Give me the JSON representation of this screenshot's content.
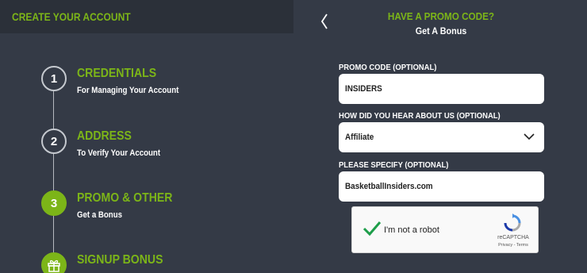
{
  "left_panel": {
    "title": "CREATE YOUR ACCOUNT",
    "steps": [
      {
        "number": "1",
        "title": "CREDENTIALS",
        "subtitle": "For Managing Your Account",
        "active": false
      },
      {
        "number": "2",
        "title": "ADDRESS",
        "subtitle": "To Verify Your Account",
        "active": false
      },
      {
        "number": "3",
        "title": "PROMO & OTHER",
        "subtitle": "Get a Bonus",
        "active": true
      },
      {
        "number": "",
        "title": "SIGNUP BONUS",
        "subtitle": "",
        "active": true,
        "icon": "gift-icon"
      }
    ]
  },
  "right_panel": {
    "back_icon": "chevron-left-icon",
    "heading": "HAVE A PROMO CODE?",
    "subheading": "Get A Bonus",
    "promo_code": {
      "label": "PROMO CODE (OPTIONAL)",
      "value": "INSIDERS"
    },
    "referral_source": {
      "label": "HOW DID YOU HEAR ABOUT US (OPTIONAL)",
      "value": "Affiliate"
    },
    "specify": {
      "label": "PLEASE SPECIFY (OPTIONAL)",
      "value": "BasketballInsiders.com"
    },
    "captcha": {
      "text": "I'm not a robot",
      "brand": "reCAPTCHA",
      "links": "Privacy - Terms",
      "checked": true
    }
  },
  "colors": {
    "accent": "#7cb518",
    "background": "#343a46",
    "header_background": "#2b3039"
  }
}
